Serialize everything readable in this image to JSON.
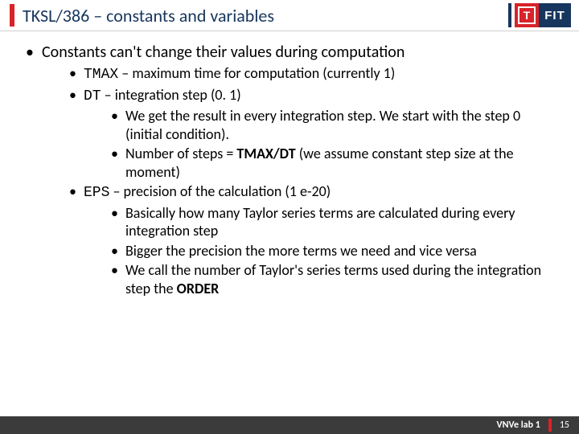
{
  "header": {
    "title": "TKSL/386 – constants and variables",
    "brand_t": "T",
    "brand_fit": "FIT"
  },
  "content": {
    "heading": "Constants can't change their values during computation",
    "tmax_code": "TMAX",
    "tmax_rest": " – maximum time for computation (currently 1)",
    "dt_code": "DT",
    "dt_rest": " – integration step (0. 1)",
    "dt_sub1": "We get the result in every integration step. We start with the step 0 (initial condition).",
    "dt_sub2_a": "Number of steps = ",
    "dt_sub2_b": "TMAX/DT",
    "dt_sub2_c": " (we assume constant step size at the moment)",
    "eps_code": "EPS",
    "eps_rest": " – precision of the calculation (1 e-20)",
    "eps_sub1": "Basically how many Taylor series terms are calculated during every integration step",
    "eps_sub2": "Bigger the precision the more terms we need and vice versa",
    "eps_sub3_a": "We call the number of Taylor's series terms used during the integration step the ",
    "eps_sub3_b": "ORDER"
  },
  "footer": {
    "lab": "VNVe lab 1",
    "page": "15"
  }
}
